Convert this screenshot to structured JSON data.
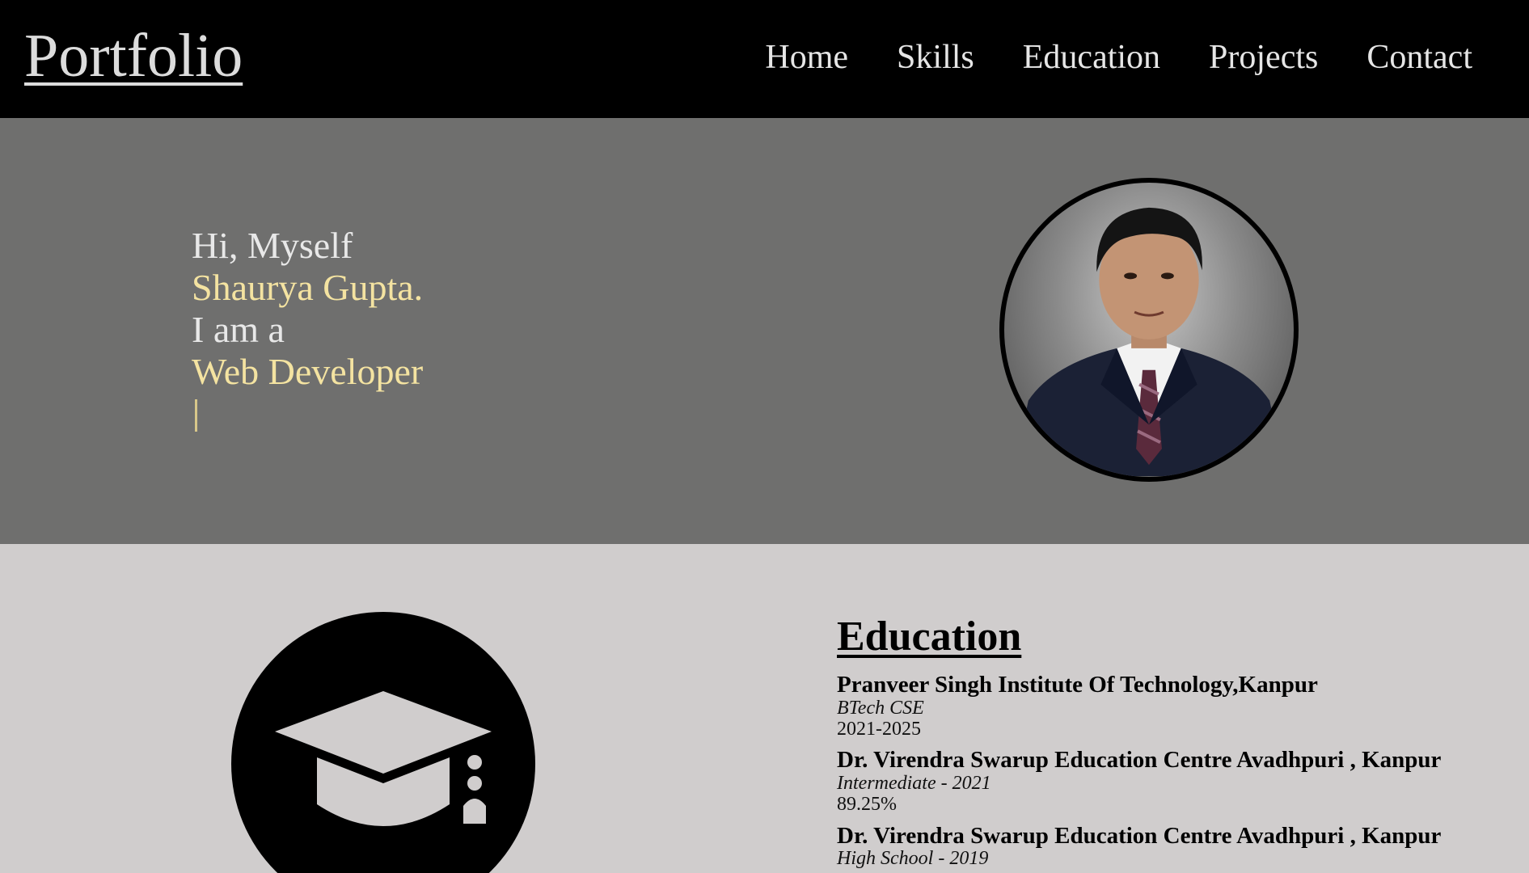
{
  "navbar": {
    "brand": "Portfolio",
    "links": [
      "Home",
      "Skills",
      "Education",
      "Projects",
      "Contact"
    ]
  },
  "hero": {
    "greeting": "Hi, Myself",
    "name": "Shaurya Gupta.",
    "role_prefix": "I am a",
    "role": "Web Developer",
    "cursor": "|"
  },
  "education": {
    "title": "Education",
    "entries": [
      {
        "school": "Pranveer Singh Institute Of Technology,Kanpur",
        "detail": "BTech CSE",
        "score": "2021-2025"
      },
      {
        "school": "Dr. Virendra Swarup Education Centre Avadhpuri , Kanpur",
        "detail": "Intermediate - 2021",
        "score": "89.25%"
      },
      {
        "school": "Dr. Virendra Swarup Education Centre Avadhpuri , Kanpur",
        "detail": "High School - 2019",
        "score": ""
      }
    ]
  },
  "colors": {
    "navbar_bg": "#000000",
    "hero_bg": "#6f6f6e",
    "accent": "#f4e3a1",
    "section_bg": "#d0cdcd"
  },
  "icons": {
    "hero_photo": "profile-photo",
    "education": "graduation-cap-icon"
  }
}
